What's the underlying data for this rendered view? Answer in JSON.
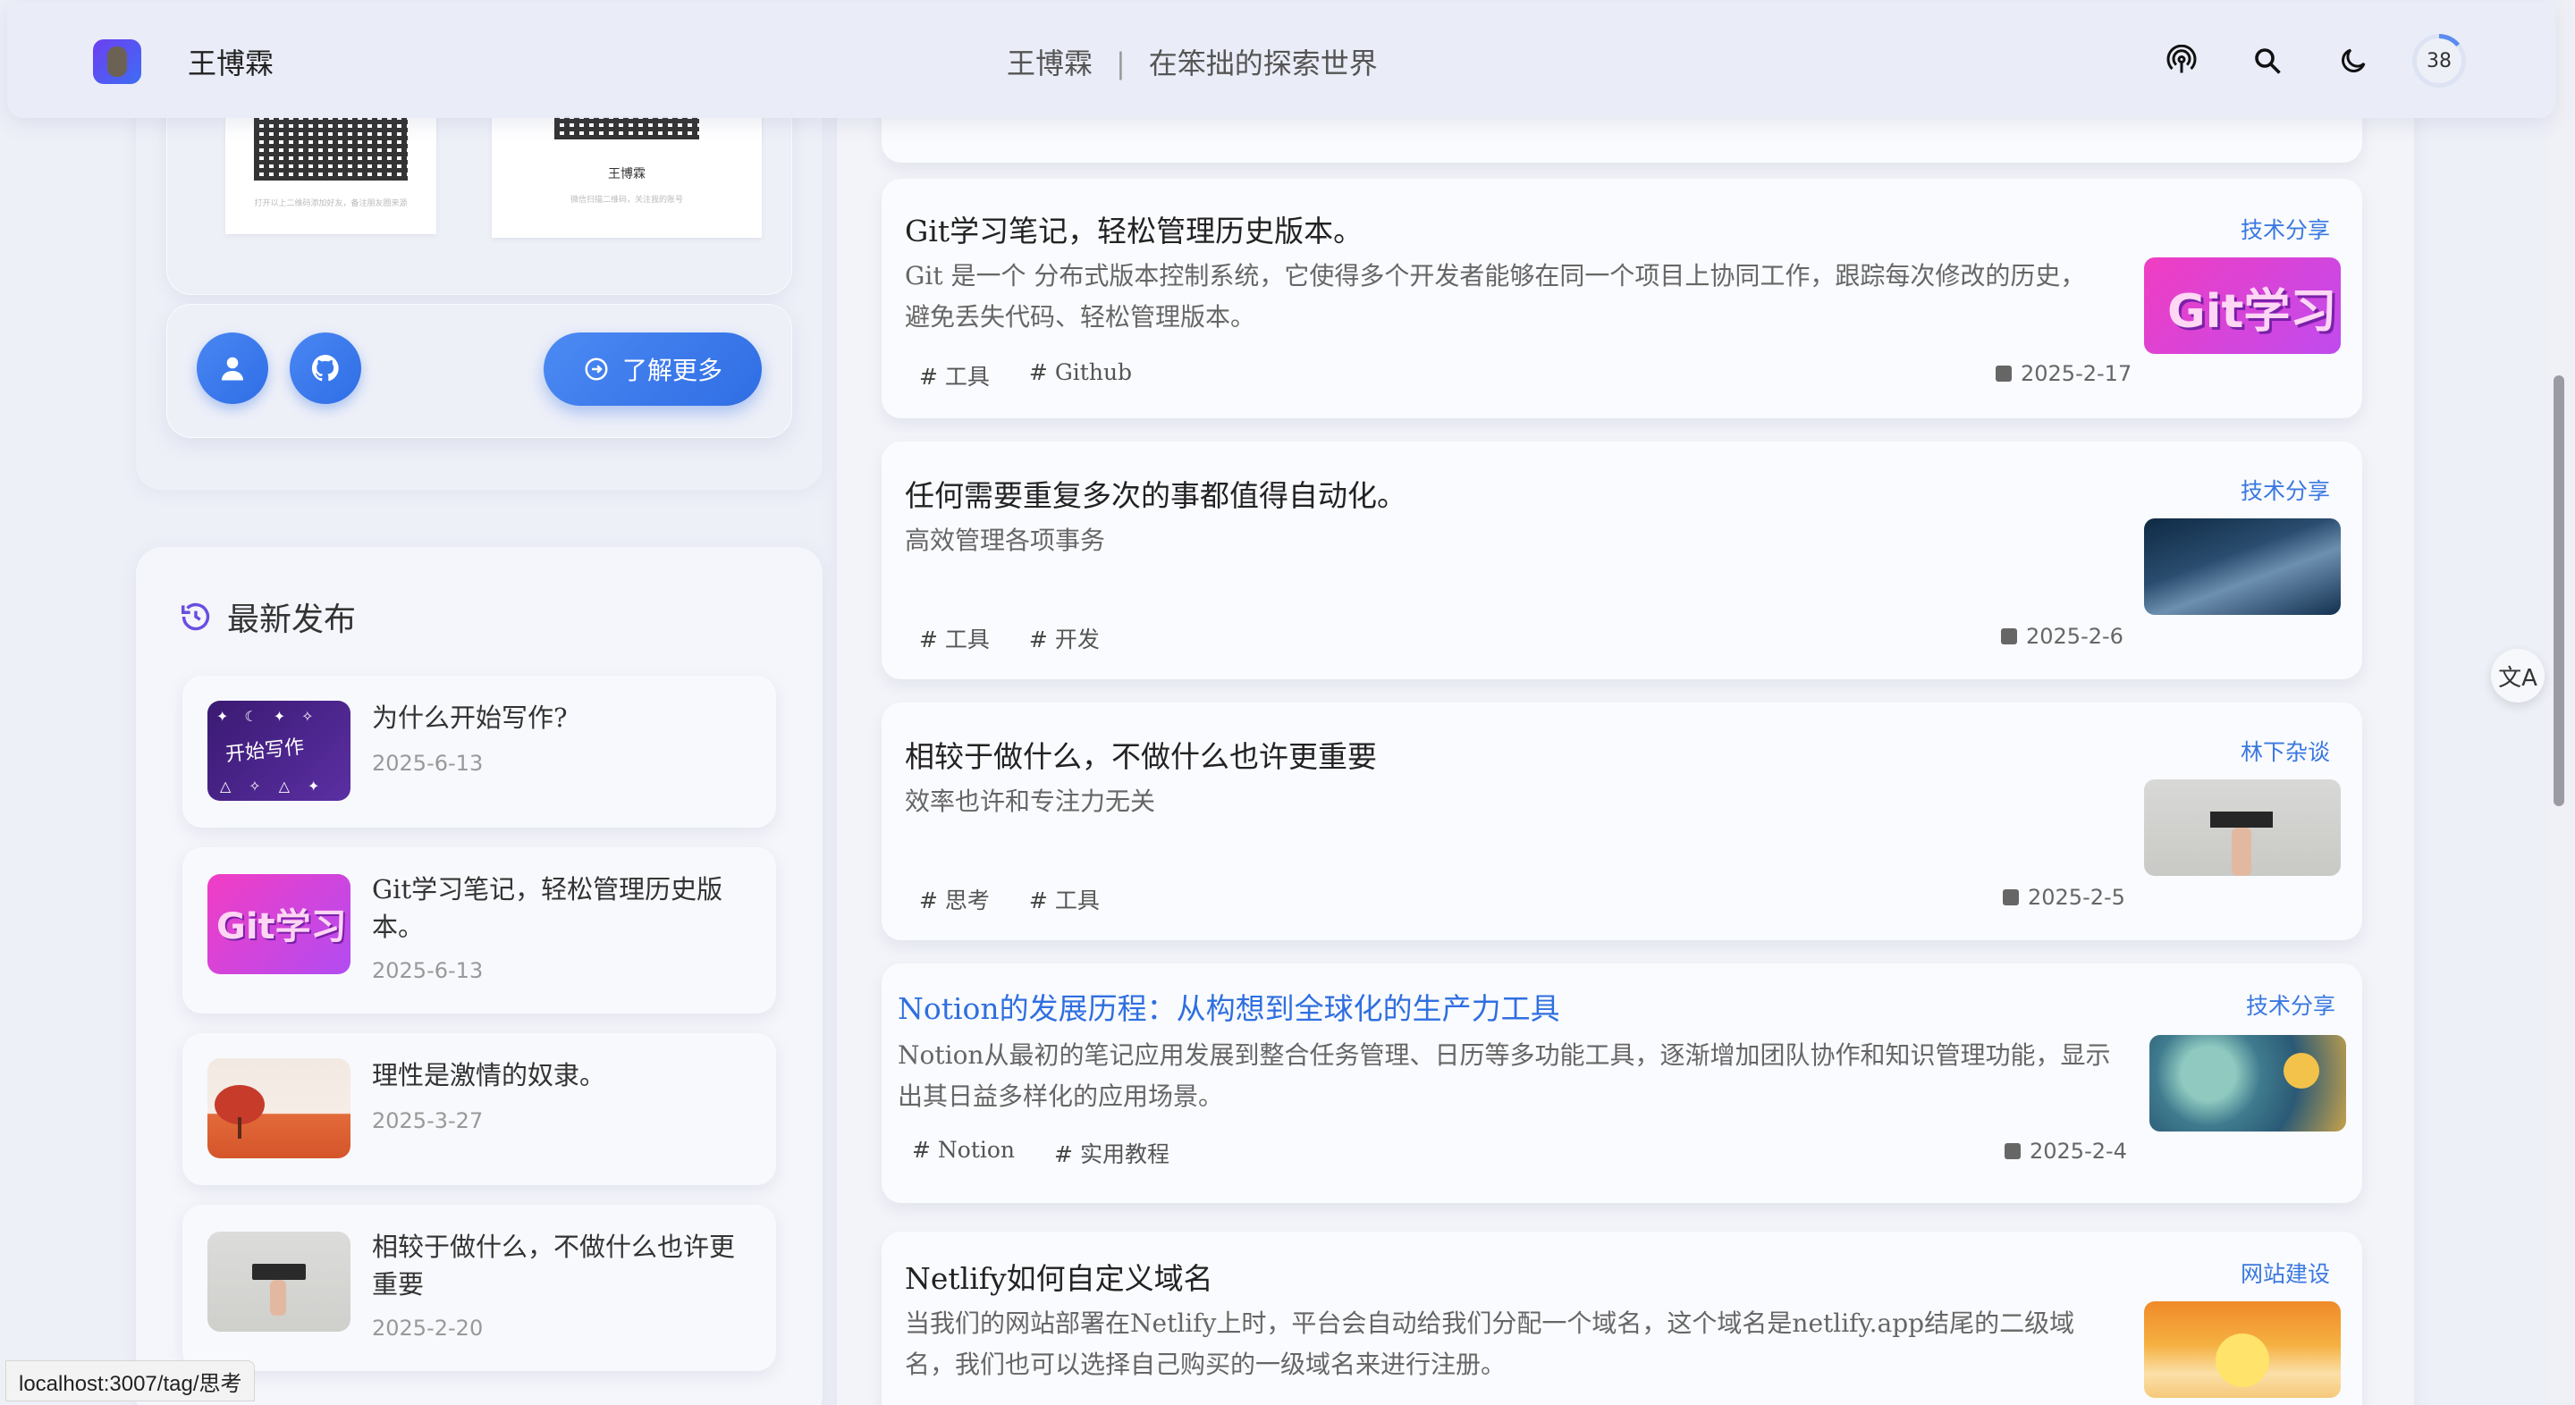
{
  "header": {
    "site_name": "王博霖",
    "center_name": "王博霖",
    "separator": "|",
    "tagline": "在笨拙的探索世界",
    "progress_value": "38",
    "progress_fraction": 0.14
  },
  "profile": {
    "qr2_name": "王博霖",
    "qr1_caption": "打开以上二维码添加好友，备注朋友圈来源",
    "qr2_caption": "微信扫描二维码，关注我的账号",
    "more_label": "了解更多"
  },
  "recent": {
    "title": "最新发布",
    "items": [
      {
        "title": "为什么开始写作?",
        "date": "2025-6-13",
        "thumb_text": "开始写作"
      },
      {
        "title": "Git学习笔记，轻松管理历史版本。",
        "date": "2025-6-13",
        "thumb_text": "Git学习"
      },
      {
        "title": "理性是激情的奴隶。",
        "date": "2025-3-27"
      },
      {
        "title": "相较于做什么，不做什么也许更重要",
        "date": "2025-2-20"
      }
    ]
  },
  "posts": [
    {
      "title": "Git学习笔记，轻松管理历史版本。",
      "desc": "Git 是一个 分布式版本控制系统，它使得多个开发者能够在同一个项目上协同工作，跟踪每次修改的历史，避免丢失代码、轻松管理版本。",
      "tags": [
        "工具",
        "Github"
      ],
      "date": "2025-2-17",
      "category": "技术分享",
      "thumb_text": "Git学习"
    },
    {
      "title": "任何需要重复多次的事都值得自动化。",
      "desc": "高效管理各项事务",
      "tags": [
        "工具",
        "开发"
      ],
      "date": "2025-2-6",
      "category": "技术分享"
    },
    {
      "title": "相较于做什么，不做什么也许更重要",
      "desc": "效率也许和专注力无关",
      "tags": [
        "思考",
        "工具"
      ],
      "date": "2025-2-5",
      "category": "林下杂谈"
    },
    {
      "title": "Notion的发展历程：从构想到全球化的生产力工具",
      "desc": "Notion从最初的笔记应用发展到整合任务管理、日历等多功能工具，逐渐增加团队协作和知识管理功能，显示出其日益多样化的应用场景。",
      "tags": [
        "Notion",
        "实用教程"
      ],
      "date": "2025-2-4",
      "category": "技术分享"
    },
    {
      "title": "Netlify如何自定义域名",
      "desc": "当我们的网站部署在Netlify上时，平台会自动给我们分配一个域名，这个域名是netlify.app结尾的二级域名，我们也可以选择自己购买的一级域名来进行注册。",
      "category": "网站建设"
    }
  ],
  "translate_label": "文A",
  "status_url": "localhost:3007/tag/思考",
  "colors": {
    "accent": "#2f6fe0",
    "button": "#3b7cf0",
    "background": "#eef0f8"
  }
}
